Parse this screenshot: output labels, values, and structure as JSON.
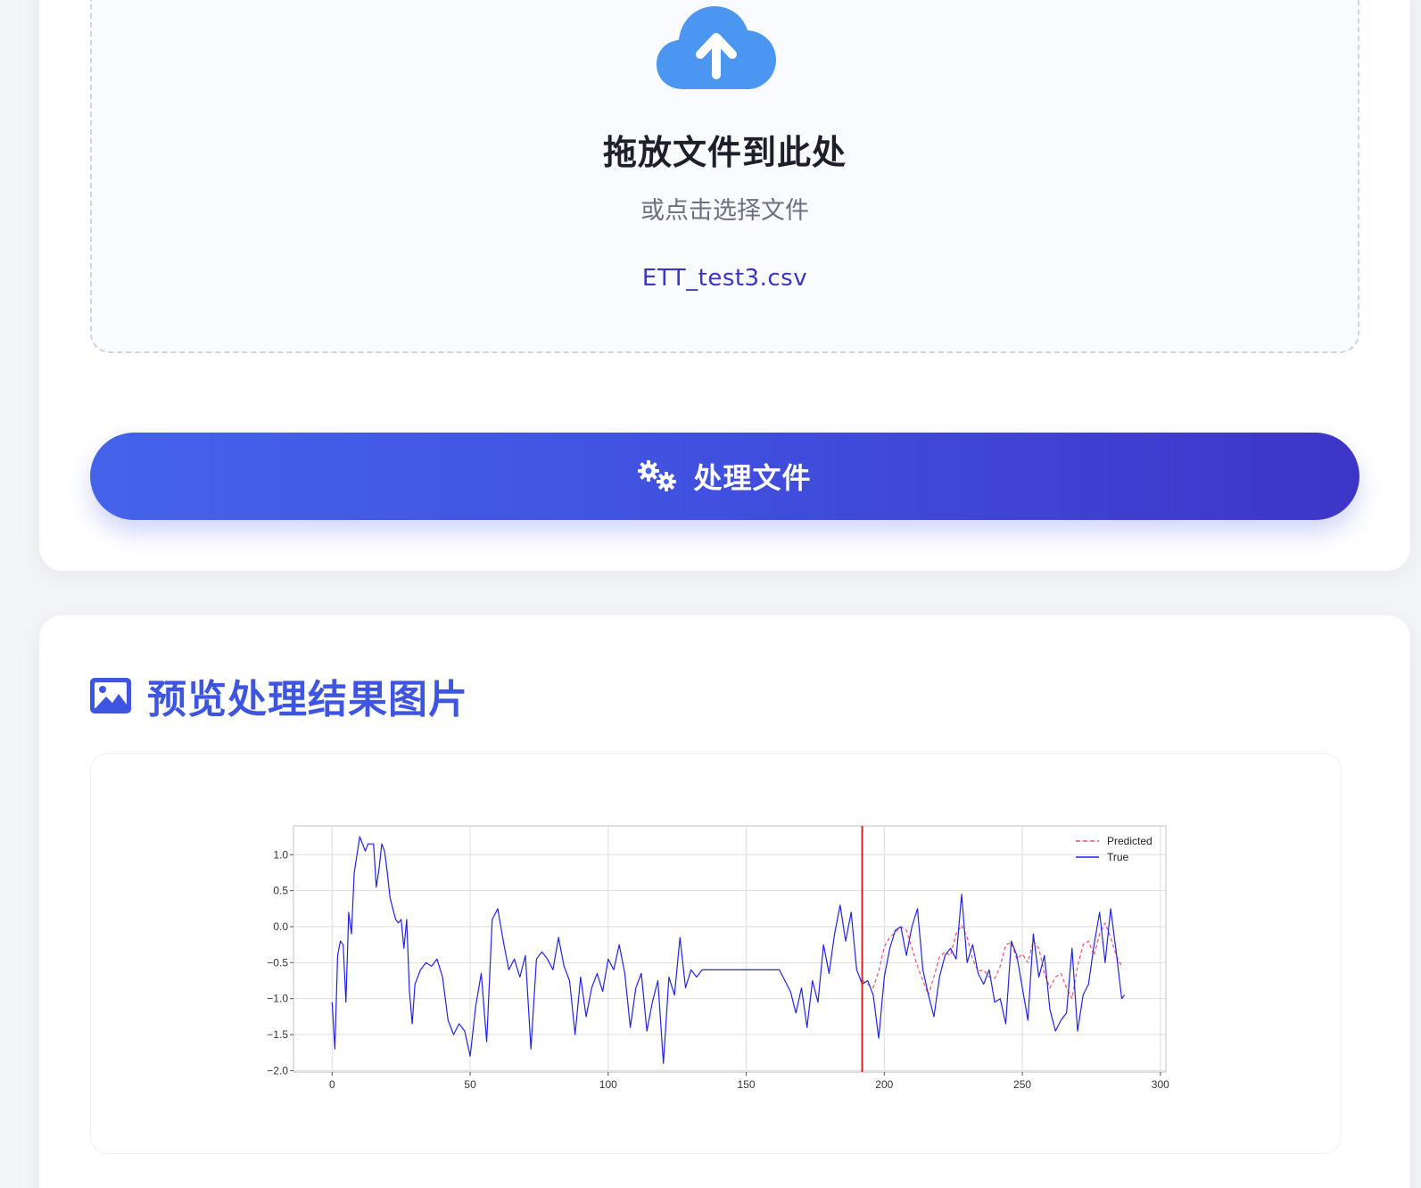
{
  "upload": {
    "drop_title": "拖放文件到此处",
    "drop_subtitle": "或点击选择文件",
    "file_name": "ETT_test3.csv",
    "cloud_icon": "cloud-upload-icon",
    "cloud_color": "#4a96f0"
  },
  "process_button": {
    "label": "处理文件",
    "icon": "gears-icon"
  },
  "preview": {
    "title": "预览处理结果图片",
    "icon": "image-icon",
    "accent": "#3d55e0"
  },
  "chart_data": {
    "type": "line",
    "title": "",
    "xlabel": "",
    "ylabel": "",
    "xlim": [
      -14,
      302
    ],
    "ylim": [
      -2.02,
      1.4
    ],
    "xticks": [
      0,
      50,
      100,
      150,
      200,
      250,
      300
    ],
    "yticks": [
      -2.0,
      -1.5,
      -1.0,
      -0.5,
      0.0,
      0.5,
      1.0
    ],
    "xtick_labels": [
      "0",
      "50",
      "100",
      "150",
      "200",
      "250",
      "300"
    ],
    "ytick_labels": [
      "−2.0",
      "−1.5",
      "−1.0",
      "−0.5",
      "0.0",
      "0.5",
      "1.0"
    ],
    "grid": true,
    "legend_position": "top-right",
    "vline": {
      "x": 192,
      "color": "#e02020"
    },
    "series": [
      {
        "name": "Predicted",
        "color": "#f0506e",
        "style": "dashed",
        "x": [
          192,
          194,
          196,
          198,
          200,
          202,
          204,
          206,
          208,
          210,
          212,
          214,
          216,
          218,
          220,
          222,
          224,
          226,
          228,
          230,
          232,
          234,
          236,
          238,
          240,
          242,
          244,
          246,
          248,
          250,
          252,
          254,
          256,
          258,
          260,
          262,
          264,
          266,
          268,
          270,
          272,
          274,
          276,
          278,
          280,
          282,
          284,
          286
        ],
        "values": [
          -0.75,
          -0.8,
          -0.85,
          -0.62,
          -0.28,
          -0.15,
          -0.08,
          0.0,
          -0.05,
          -0.3,
          -0.55,
          -0.75,
          -0.95,
          -0.7,
          -0.42,
          -0.35,
          -0.4,
          -0.1,
          0.02,
          -0.15,
          -0.45,
          -0.62,
          -0.6,
          -0.7,
          -0.72,
          -0.55,
          -0.25,
          -0.22,
          -0.45,
          -0.38,
          -0.5,
          -0.2,
          -0.3,
          -0.65,
          -0.85,
          -0.7,
          -0.65,
          -0.85,
          -1.0,
          -0.55,
          -0.25,
          -0.2,
          -0.4,
          -0.1,
          0.05,
          -0.15,
          -0.4,
          -0.55
        ]
      },
      {
        "name": "True",
        "color": "#2323e6",
        "style": "solid",
        "x": [
          0,
          1,
          2,
          3,
          4,
          5,
          6,
          7,
          8,
          9,
          10,
          11,
          12,
          13,
          14,
          15,
          16,
          17,
          18,
          19,
          20,
          21,
          22,
          23,
          24,
          25,
          26,
          27,
          28,
          29,
          30,
          32,
          34,
          36,
          38,
          40,
          42,
          44,
          46,
          48,
          50,
          52,
          54,
          56,
          58,
          60,
          62,
          64,
          66,
          68,
          70,
          72,
          74,
          76,
          78,
          80,
          82,
          84,
          86,
          88,
          90,
          92,
          94,
          96,
          98,
          100,
          102,
          104,
          106,
          108,
          110,
          112,
          114,
          116,
          118,
          120,
          122,
          124,
          126,
          128,
          130,
          132,
          134,
          136,
          138,
          140,
          142,
          144,
          146,
          148,
          150,
          152,
          154,
          156,
          158,
          160,
          162,
          164,
          166,
          168,
          170,
          172,
          174,
          176,
          178,
          180,
          182,
          184,
          186,
          188,
          190,
          192,
          194,
          196,
          198,
          200,
          202,
          204,
          206,
          208,
          210,
          212,
          214,
          216,
          218,
          220,
          222,
          224,
          226,
          228,
          230,
          232,
          234,
          236,
          238,
          240,
          242,
          244,
          246,
          248,
          250,
          252,
          254,
          256,
          258,
          260,
          262,
          264,
          266,
          268,
          270,
          272,
          274,
          276,
          278,
          280,
          282,
          284,
          286,
          287
        ],
        "values": [
          -1.05,
          -1.7,
          -0.4,
          -0.2,
          -0.25,
          -1.05,
          0.2,
          -0.1,
          0.75,
          1.0,
          1.25,
          1.15,
          1.05,
          1.15,
          1.15,
          1.15,
          0.55,
          0.8,
          1.15,
          1.05,
          0.75,
          0.4,
          0.25,
          0.1,
          0.05,
          0.1,
          -0.3,
          0.1,
          -0.9,
          -1.35,
          -0.8,
          -0.6,
          -0.5,
          -0.55,
          -0.45,
          -0.7,
          -1.3,
          -1.5,
          -1.35,
          -1.45,
          -1.8,
          -1.1,
          -0.65,
          -1.6,
          0.1,
          0.25,
          -0.2,
          -0.6,
          -0.45,
          -0.7,
          -0.4,
          -1.7,
          -0.45,
          -0.35,
          -0.45,
          -0.6,
          -0.15,
          -0.55,
          -0.75,
          -1.5,
          -0.7,
          -1.25,
          -0.85,
          -0.65,
          -0.9,
          -0.45,
          -0.6,
          -0.25,
          -0.65,
          -1.4,
          -0.85,
          -0.65,
          -1.45,
          -1.05,
          -0.75,
          -1.9,
          -0.7,
          -0.95,
          -0.15,
          -0.85,
          -0.6,
          -0.7,
          -0.6,
          -0.6,
          -0.6,
          -0.6,
          -0.6,
          -0.6,
          -0.6,
          -0.6,
          -0.6,
          -0.6,
          -0.6,
          -0.6,
          -0.6,
          -0.6,
          -0.6,
          -0.75,
          -0.9,
          -1.2,
          -0.85,
          -1.4,
          -0.75,
          -1.05,
          -0.25,
          -0.65,
          -0.1,
          0.3,
          -0.2,
          0.2,
          -0.6,
          -0.8,
          -0.75,
          -0.95,
          -1.55,
          -0.7,
          -0.3,
          -0.05,
          0.0,
          -0.4,
          0.0,
          0.25,
          -0.6,
          -0.95,
          -1.25,
          -0.7,
          -0.4,
          -0.3,
          -0.45,
          0.45,
          -0.5,
          -0.25,
          -0.65,
          -0.8,
          -0.6,
          -1.05,
          -1.0,
          -1.35,
          -0.2,
          -0.4,
          -0.85,
          -1.3,
          -0.1,
          -0.7,
          -0.4,
          -1.15,
          -1.45,
          -1.3,
          -1.2,
          -0.3,
          -1.45,
          -0.95,
          -0.8,
          -0.25,
          0.2,
          -0.5,
          0.25,
          -0.35,
          -1.0,
          -0.95
        ]
      }
    ]
  }
}
